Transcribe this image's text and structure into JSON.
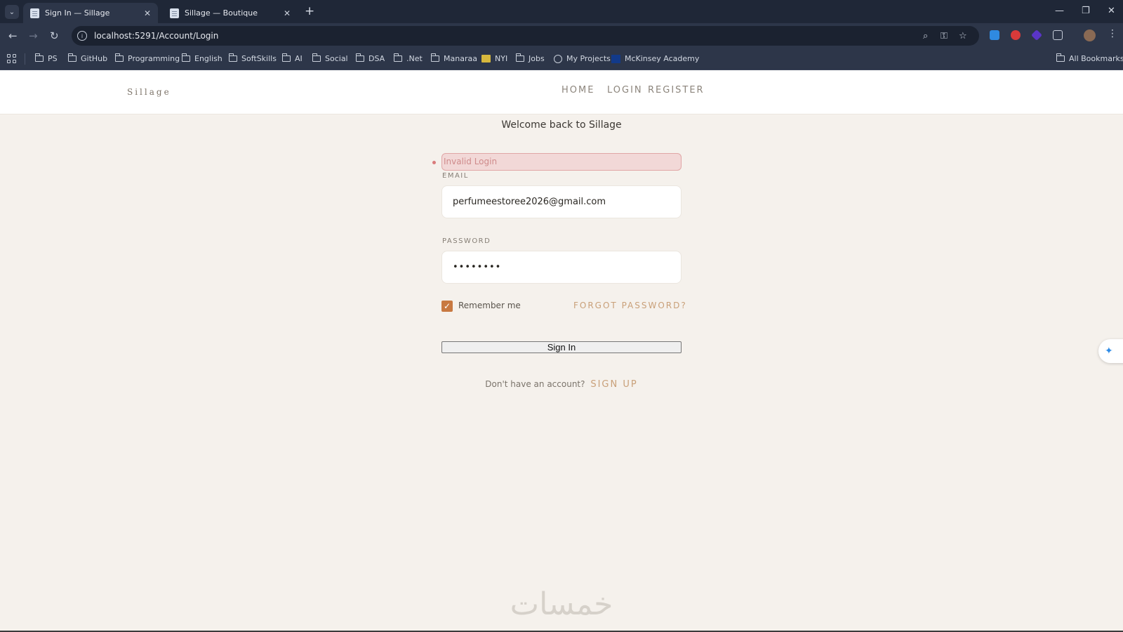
{
  "browser": {
    "tabs": [
      {
        "title": "Sign In — Sillage",
        "active": true
      },
      {
        "title": "Sillage — Boutique",
        "active": false
      }
    ],
    "url": "localhost:5291/Account/Login",
    "bookmarks": [
      "PS",
      "GitHub",
      "Programming",
      "English",
      "SoftSkills",
      "AI",
      "Social",
      "DSA",
      ".Net",
      "Manaraa",
      "NYI",
      "Jobs",
      "My Projects",
      "McKinsey Academy"
    ],
    "all_bookmarks": "All Bookmarks"
  },
  "site": {
    "logo": "Sillage",
    "nav": [
      "HOME",
      "LOGIN",
      "REGISTER"
    ]
  },
  "login": {
    "welcome": "Welcome back to Sillage",
    "error": "Invalid Login",
    "email_label": "EMAIL",
    "email_value": "perfumeestoree2026@gmail.com",
    "password_label": "PASSWORD",
    "password_value": "••••••••",
    "remember_label": "Remember me",
    "remember_checked": true,
    "forgot_label": "FORGOT PASSWORD?",
    "submit_label": "Sign In",
    "signup_prompt": "Don't have an account?",
    "signup_link": "SIGN UP"
  },
  "colors": {
    "accent": "#c87941",
    "link": "#c9a079",
    "error_bg": "#f2d8d7",
    "page_bg": "#f5f1ec"
  },
  "watermark": "خمسات"
}
